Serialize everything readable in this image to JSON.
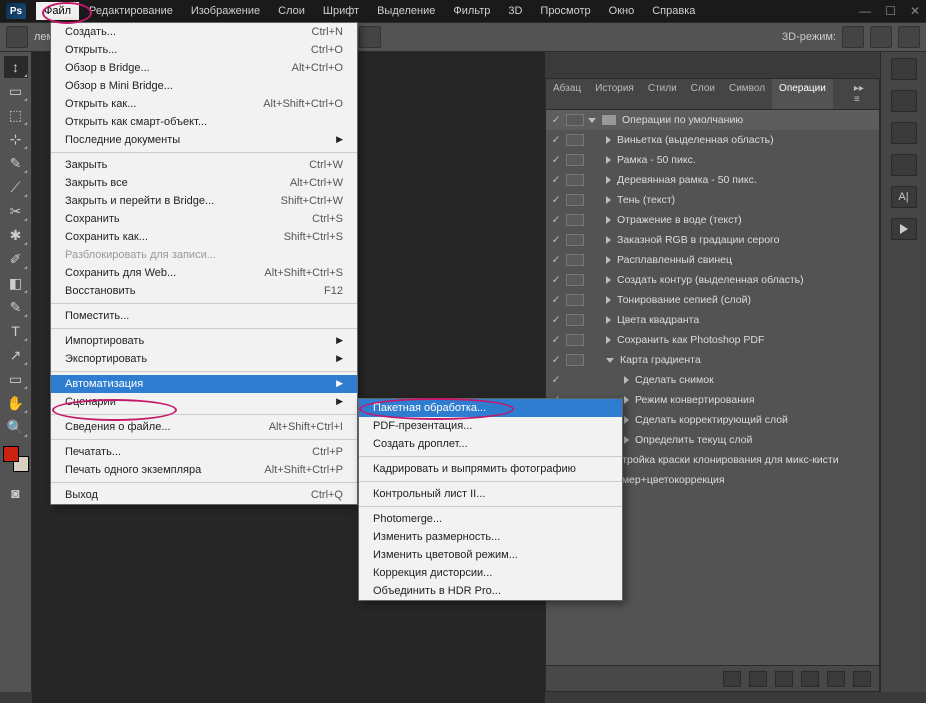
{
  "menubar": [
    "Файл",
    "Редактирование",
    "Изображение",
    "Слои",
    "Шрифт",
    "Выделение",
    "Фильтр",
    "3D",
    "Просмотр",
    "Окно",
    "Справка"
  ],
  "optionbar": {
    "fragment": "лем.",
    "mode_label": "3D-режим:"
  },
  "file_menu": [
    [
      {
        "l": "Создать...",
        "s": "Ctrl+N"
      },
      {
        "l": "Открыть...",
        "s": "Ctrl+O"
      },
      {
        "l": "Обзор в Bridge...",
        "s": "Alt+Ctrl+O"
      },
      {
        "l": "Обзор в Mini Bridge..."
      },
      {
        "l": "Открыть как...",
        "s": "Alt+Shift+Ctrl+O"
      },
      {
        "l": "Открыть как смарт-объект..."
      },
      {
        "l": "Последние документы",
        "sub": true
      }
    ],
    [
      {
        "l": "Закрыть",
        "s": "Ctrl+W"
      },
      {
        "l": "Закрыть все",
        "s": "Alt+Ctrl+W"
      },
      {
        "l": "Закрыть и перейти в Bridge...",
        "s": "Shift+Ctrl+W"
      },
      {
        "l": "Сохранить",
        "s": "Ctrl+S"
      },
      {
        "l": "Сохранить как...",
        "s": "Shift+Ctrl+S"
      },
      {
        "l": "Разблокировать для записи...",
        "disabled": true
      },
      {
        "l": "Сохранить для Web...",
        "s": "Alt+Shift+Ctrl+S"
      },
      {
        "l": "Восстановить",
        "s": "F12"
      }
    ],
    [
      {
        "l": "Поместить..."
      }
    ],
    [
      {
        "l": "Импортировать",
        "sub": true
      },
      {
        "l": "Экспортировать",
        "sub": true
      }
    ],
    [
      {
        "l": "Автоматизация",
        "sub": true,
        "hl": true
      },
      {
        "l": "Сценарии",
        "sub": true
      }
    ],
    [
      {
        "l": "Сведения о файле...",
        "s": "Alt+Shift+Ctrl+I"
      }
    ],
    [
      {
        "l": "Печатать...",
        "s": "Ctrl+P"
      },
      {
        "l": "Печать одного экземпляра",
        "s": "Alt+Shift+Ctrl+P"
      }
    ],
    [
      {
        "l": "Выход",
        "s": "Ctrl+Q"
      }
    ]
  ],
  "automation_submenu": [
    [
      {
        "l": "Пакетная обработка...",
        "hl": true
      },
      {
        "l": "PDF-презентация..."
      },
      {
        "l": "Создать дроплет..."
      }
    ],
    [
      {
        "l": "Кадрировать и выпрямить фотографию"
      }
    ],
    [
      {
        "l": "Контрольный лист II..."
      }
    ],
    [
      {
        "l": "Photomerge..."
      },
      {
        "l": "Изменить размерность..."
      },
      {
        "l": "Изменить цветовой режим..."
      },
      {
        "l": "Коррекция дисторсии..."
      },
      {
        "l": "Объединить в HDR Pro..."
      }
    ]
  ],
  "panel_tabs": [
    "Абзац",
    "История",
    "Стили",
    "Слои",
    "Символ",
    "Операции"
  ],
  "actions": {
    "set": "Операции по умолчанию",
    "items": [
      {
        "l": "Виньетка (выделенная область)"
      },
      {
        "l": "Рамка - 50 пикс."
      },
      {
        "l": "Деревянная рамка - 50 пикс."
      },
      {
        "l": "Тень (текст)"
      },
      {
        "l": "Отражение в воде (текст)"
      },
      {
        "l": "Заказной RGB в градации серого"
      },
      {
        "l": "Расплавленный свинец"
      },
      {
        "l": "Создать контур (выделенная область)"
      },
      {
        "l": "Тонирование сепией (слой)"
      },
      {
        "l": "Цвета квадранта"
      },
      {
        "l": "Сохранить как Photoshop PDF"
      },
      {
        "l": "Карта градиента",
        "expanded": true,
        "children": [
          "Сделать снимок",
          "Режим конвертирования",
          "Сделать корректирующий слой",
          "Определить текущ слой"
        ]
      },
      {
        "l": "стройка краски клонирования для микс-кисти"
      },
      {
        "l": "змер+цветокоррекция"
      }
    ]
  },
  "logo_text": "Ps"
}
